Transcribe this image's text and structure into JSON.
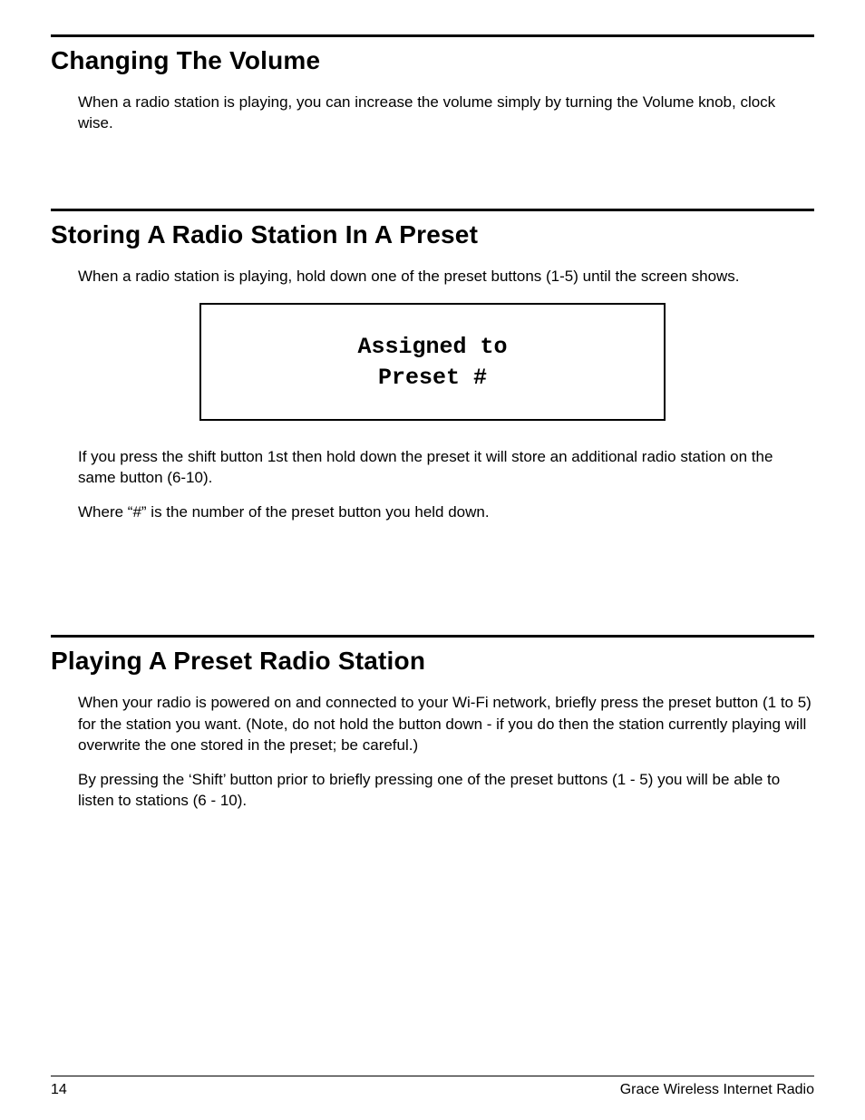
{
  "sections": {
    "volume": {
      "heading": "Changing The Volume",
      "p1": "When a radio station is playing, you can increase the volume simply by turning the Volume knob, clock wise."
    },
    "storing": {
      "heading": "Storing A Radio Station In A Preset",
      "p1": "When a radio station is playing, hold down one of the preset buttons (1-5) until the screen shows.",
      "display_line1": "Assigned to",
      "display_line2": "Preset #",
      "p2": "If you press the shift button 1st then hold down the preset it will store an additional radio station on the same button (6-10).",
      "p3": "Where “#” is the number of the preset button you held down."
    },
    "playing": {
      "heading": "Playing A Preset Radio Station",
      "p1": "When your radio is powered on and connected to your Wi-Fi network, briefly press the preset button (1 to 5) for the station you want. (Note, do not hold the button down - if you do then the station currently playing will overwrite the one stored in the preset; be careful.)",
      "p2": "By pressing the ‘Shift’ button prior to briefly pressing one of the preset buttons (1 - 5) you will be able to listen to stations (6 - 10)."
    }
  },
  "footer": {
    "page_number": "14",
    "doc_title": "Grace Wireless Internet Radio"
  }
}
